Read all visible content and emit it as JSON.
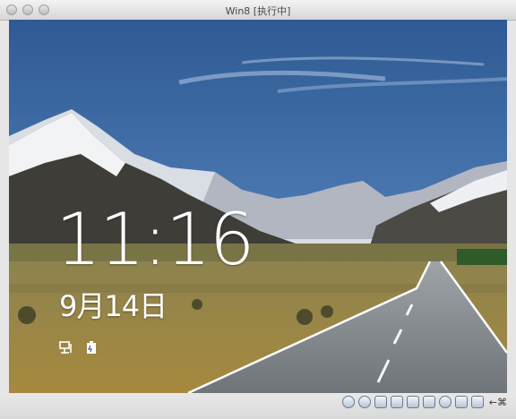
{
  "window": {
    "title": "Win8 [执行中]"
  },
  "lock_screen": {
    "time": "11:16",
    "date": "9月14日",
    "status_icons": [
      "network-icon",
      "battery-icon"
    ]
  },
  "statusbar": {
    "icons": [
      "hard-disk-icon",
      "optical-drive-icon",
      "usb-icon",
      "shared-folder-icon",
      "display-icon",
      "video-capture-icon",
      "network-adapter-icon",
      "guest-additions-icon",
      "mouse-integration-icon"
    ],
    "host_key": "←⌘"
  }
}
